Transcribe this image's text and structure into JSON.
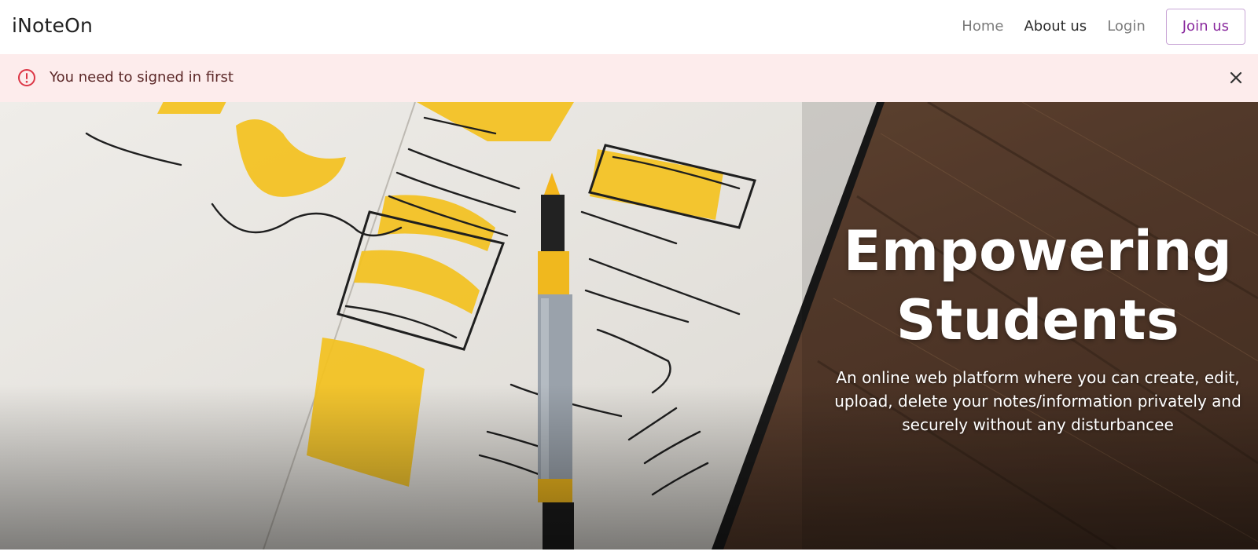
{
  "navbar": {
    "brand": "iNoteOn",
    "links": [
      {
        "label": "Home",
        "active": false
      },
      {
        "label": "About us",
        "active": true
      },
      {
        "label": "Login",
        "active": false
      }
    ],
    "join_label": "Join us"
  },
  "alert": {
    "message": "You need to signed in first",
    "icon": "exclamation-circle-icon",
    "color": "#fdecec"
  },
  "hero": {
    "title_line1": "Empowering",
    "title_line2": "Students",
    "subtitle": "An online web platform where you can create, edit, upload, delete your notes/information privately and securely without any disturbancee"
  },
  "colors": {
    "accent": "#8a2a9e",
    "alert_icon": "#dc3545",
    "wood": "#6a4a33",
    "highlighter": "#f4c21f"
  }
}
